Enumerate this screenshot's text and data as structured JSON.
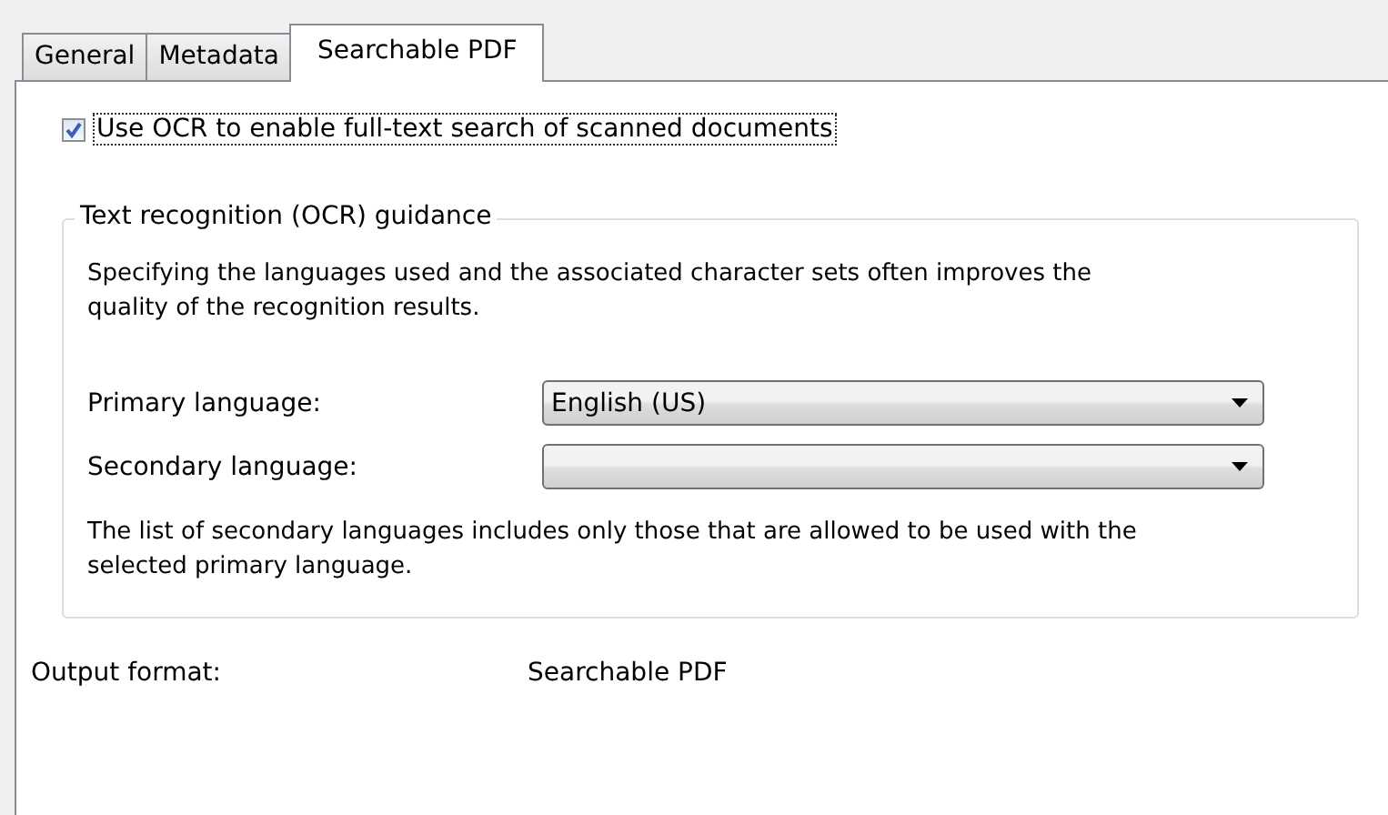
{
  "tabs": [
    {
      "label": "General",
      "selected": false
    },
    {
      "label": "Metadata",
      "selected": false
    },
    {
      "label": "Searchable PDF",
      "selected": true
    }
  ],
  "ocr_checkbox": {
    "label": "Use OCR to enable full-text search of scanned documents",
    "checked": true
  },
  "group": {
    "title": "Text recognition (OCR) guidance",
    "description": "Specifying the languages used and the associated character sets often improves the quality of the recognition results.",
    "fields": [
      {
        "label": "Primary language:",
        "value": "English (US)"
      },
      {
        "label": "Secondary language:"
      }
    ],
    "note": "The list of secondary languages includes only those that are allowed to be used with the selected primary language."
  },
  "output": {
    "label": "Output format:",
    "value": "Searchable PDF"
  }
}
